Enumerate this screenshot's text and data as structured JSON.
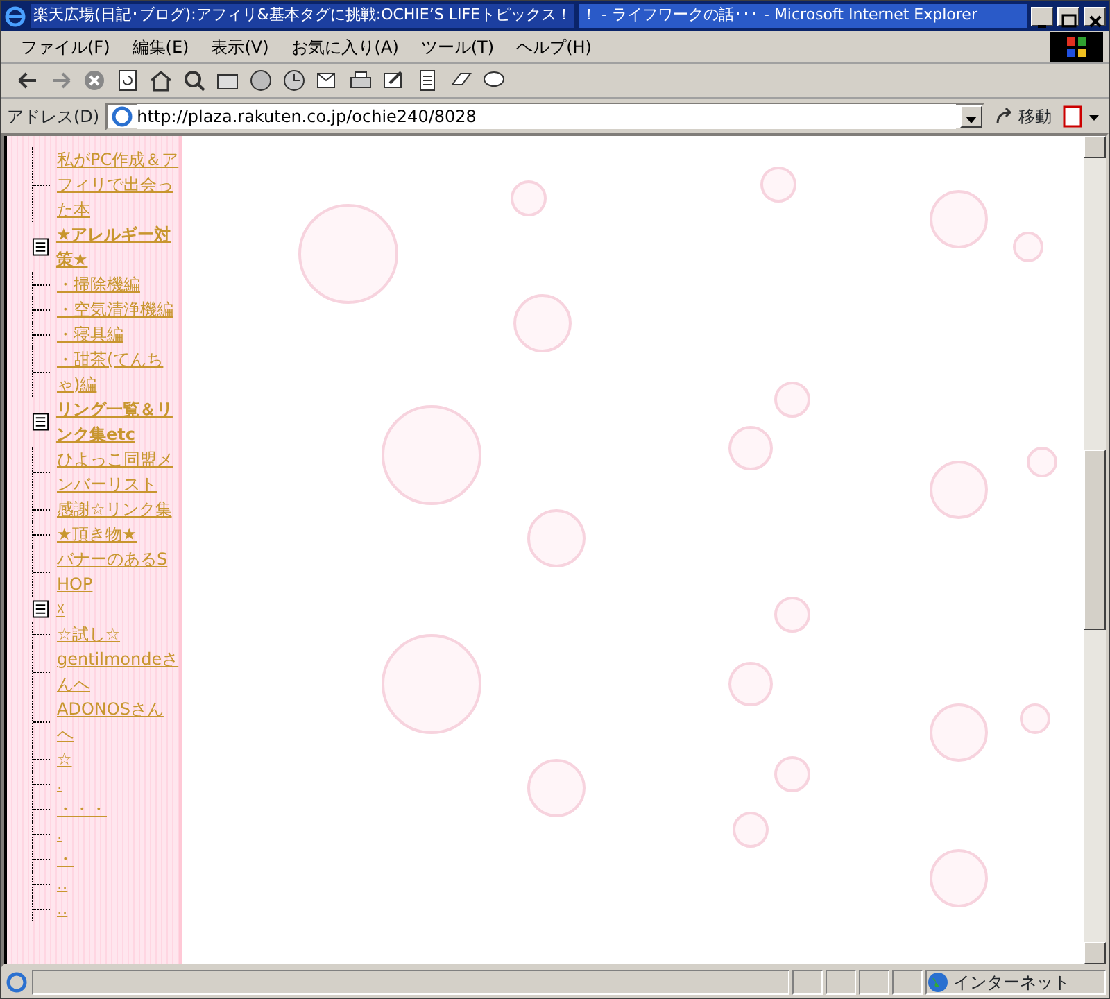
{
  "window": {
    "title_segments": [
      {
        "text": "楽天広場(日記･ブログ):アフィリ&基本タグに挑戦:OCHIE’S LIFEトピックス！",
        "highlighted": true
      },
      {
        "text": "！ - ライフワークの話･･･ - Microsoft Internet Explorer",
        "highlighted": false
      }
    ]
  },
  "menu": [
    "ファイル(F)",
    "編集(E)",
    "表示(V)",
    "お気に入り(A)",
    "ツール(T)",
    "ヘルプ(H)"
  ],
  "address_bar": {
    "label": "アドレス(D)",
    "value": "http://plaza.rakuten.co.jp/ochie240/8028",
    "go_button": "移動"
  },
  "sidebar": {
    "tree": [
      {
        "kind": "link",
        "text": "私がPC作成＆アフィリで出会った本"
      },
      {
        "kind": "category",
        "text": "★アレルギー対策★",
        "children": [
          {
            "kind": "link",
            "text": "・掃除機編"
          },
          {
            "kind": "link",
            "text": "・空気清浄機編"
          },
          {
            "kind": "link",
            "text": "・寝具編"
          },
          {
            "kind": "link",
            "text": "・甜茶(てんちゃ)編"
          }
        ]
      },
      {
        "kind": "category",
        "text": "リング一覧＆リンク集etc",
        "children": [
          {
            "kind": "link",
            "text": "ひよっこ同盟メンバーリスト"
          },
          {
            "kind": "link",
            "text": "感謝☆リンク集"
          },
          {
            "kind": "link",
            "text": "★頂き物★"
          },
          {
            "kind": "link",
            "text": "バナーのあるSHOP"
          }
        ]
      },
      {
        "kind": "category",
        "text": "☓",
        "children": [
          {
            "kind": "link",
            "text": "☆試し☆"
          },
          {
            "kind": "link",
            "text": "gentilmondeさんへ"
          },
          {
            "kind": "link",
            "text": "ADONOSさんへ"
          },
          {
            "kind": "link",
            "text": "☆"
          },
          {
            "kind": "link",
            "text": "."
          },
          {
            "kind": "link",
            "text": "・・・"
          },
          {
            "kind": "link",
            "text": "."
          },
          {
            "kind": "link",
            "text": "・"
          },
          {
            "kind": "link",
            "text": ".."
          },
          {
            "kind": "link",
            "text": ".."
          }
        ]
      }
    ]
  },
  "status_bar": {
    "zone": "インターネット"
  }
}
